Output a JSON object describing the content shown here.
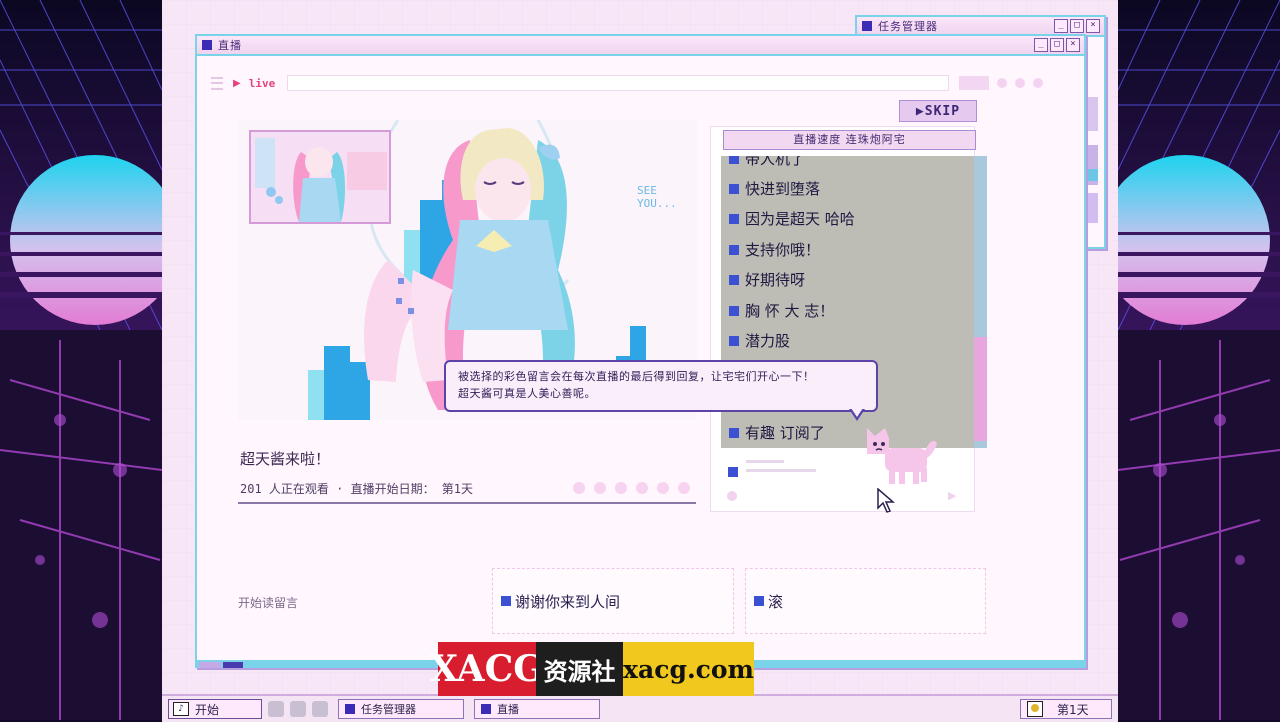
{
  "background_window": {
    "title": "任务管理器"
  },
  "main_window": {
    "title": "直播",
    "address": {
      "live_label": "live"
    },
    "skip_label": "▶SKIP",
    "video": {
      "overlay_text": "SEE YOU..."
    },
    "stream": {
      "title": "超天酱来啦！",
      "meta": "201 人正在观看 · 直播开始日期： 第1天"
    },
    "chat": {
      "header": "直播速度 连珠炮阿宅",
      "messages": [
        "带人机了",
        "快进到堕落",
        "因为是超天 哈哈",
        "支持你哦！",
        "好期待呀",
        "胸 怀 大 志！",
        "潜力股",
        "有趣 订阅了"
      ]
    },
    "tooltip": "被选择的彩色留言会在每次直播的最后得到回复，让宅宅们开心一下！\n超天酱可真是人美心善呢。",
    "reply": {
      "label": "开始读留言",
      "options": [
        "谢谢你来到人间",
        "滚"
      ]
    }
  },
  "taskbar": {
    "start_label": "开始",
    "tasks": [
      "任务管理器",
      "直播"
    ],
    "day_label": "第1天"
  },
  "watermark": {
    "part1": "XACG",
    "part2": "资源社",
    "part3": "xacg.com"
  },
  "colors": {
    "accent": "#7bd3ea",
    "chat_bullet": "#3c50d4",
    "live_red": "#e2437f",
    "window_bg": "#fff7fd"
  }
}
